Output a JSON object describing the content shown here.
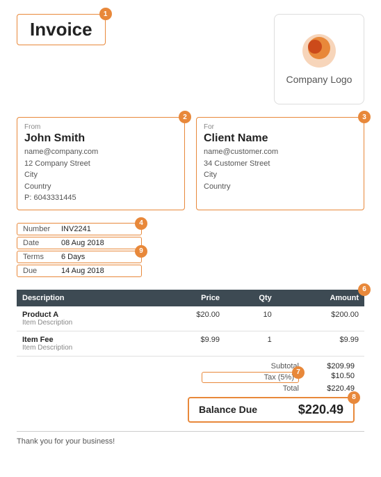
{
  "header": {
    "invoice_title": "Invoice",
    "badge_number": "1",
    "logo_text": "Company Logo"
  },
  "from": {
    "label": "From",
    "name": "John Smith",
    "email": "name@company.com",
    "address_line1": "12 Company Street",
    "address_line2": "City",
    "address_line3": "Country",
    "phone": "P: 6043331445",
    "badge": "2"
  },
  "for": {
    "label": "For",
    "name": "Client Name",
    "email": "name@customer.com",
    "address_line1": "34 Customer Street",
    "address_line2": "City",
    "address_line3": "Country",
    "badge": "3"
  },
  "meta": {
    "badge": "4",
    "badge9": "9",
    "rows": [
      {
        "key": "Number",
        "value": "INV2241"
      },
      {
        "key": "Date",
        "value": "08 Aug 2018"
      },
      {
        "key": "Terms",
        "value": "6 Days"
      },
      {
        "key": "Due",
        "value": "14 Aug 2018"
      }
    ]
  },
  "table": {
    "badge": "6",
    "headers": {
      "description": "Description",
      "price": "Price",
      "qty": "Qty",
      "amount": "Amount"
    },
    "items": [
      {
        "name": "Product A",
        "description": "Item Description",
        "price": "$20.00",
        "qty": "10",
        "amount": "$200.00"
      },
      {
        "name": "Item Fee",
        "description": "Item Description",
        "price": "$9.99",
        "qty": "1",
        "amount": "$9.99"
      }
    ]
  },
  "totals": {
    "badge7": "7",
    "subtotal_label": "Subtotal",
    "subtotal_value": "$209.99",
    "tax_label": "Tax (5%)",
    "tax_value": "$10.50",
    "total_label": "Total",
    "total_value": "$220.49",
    "balance_due_label": "Balance Due",
    "balance_due_value": "$220.49",
    "badge8": "8"
  },
  "footer": {
    "text": "Thank you for your business!"
  }
}
